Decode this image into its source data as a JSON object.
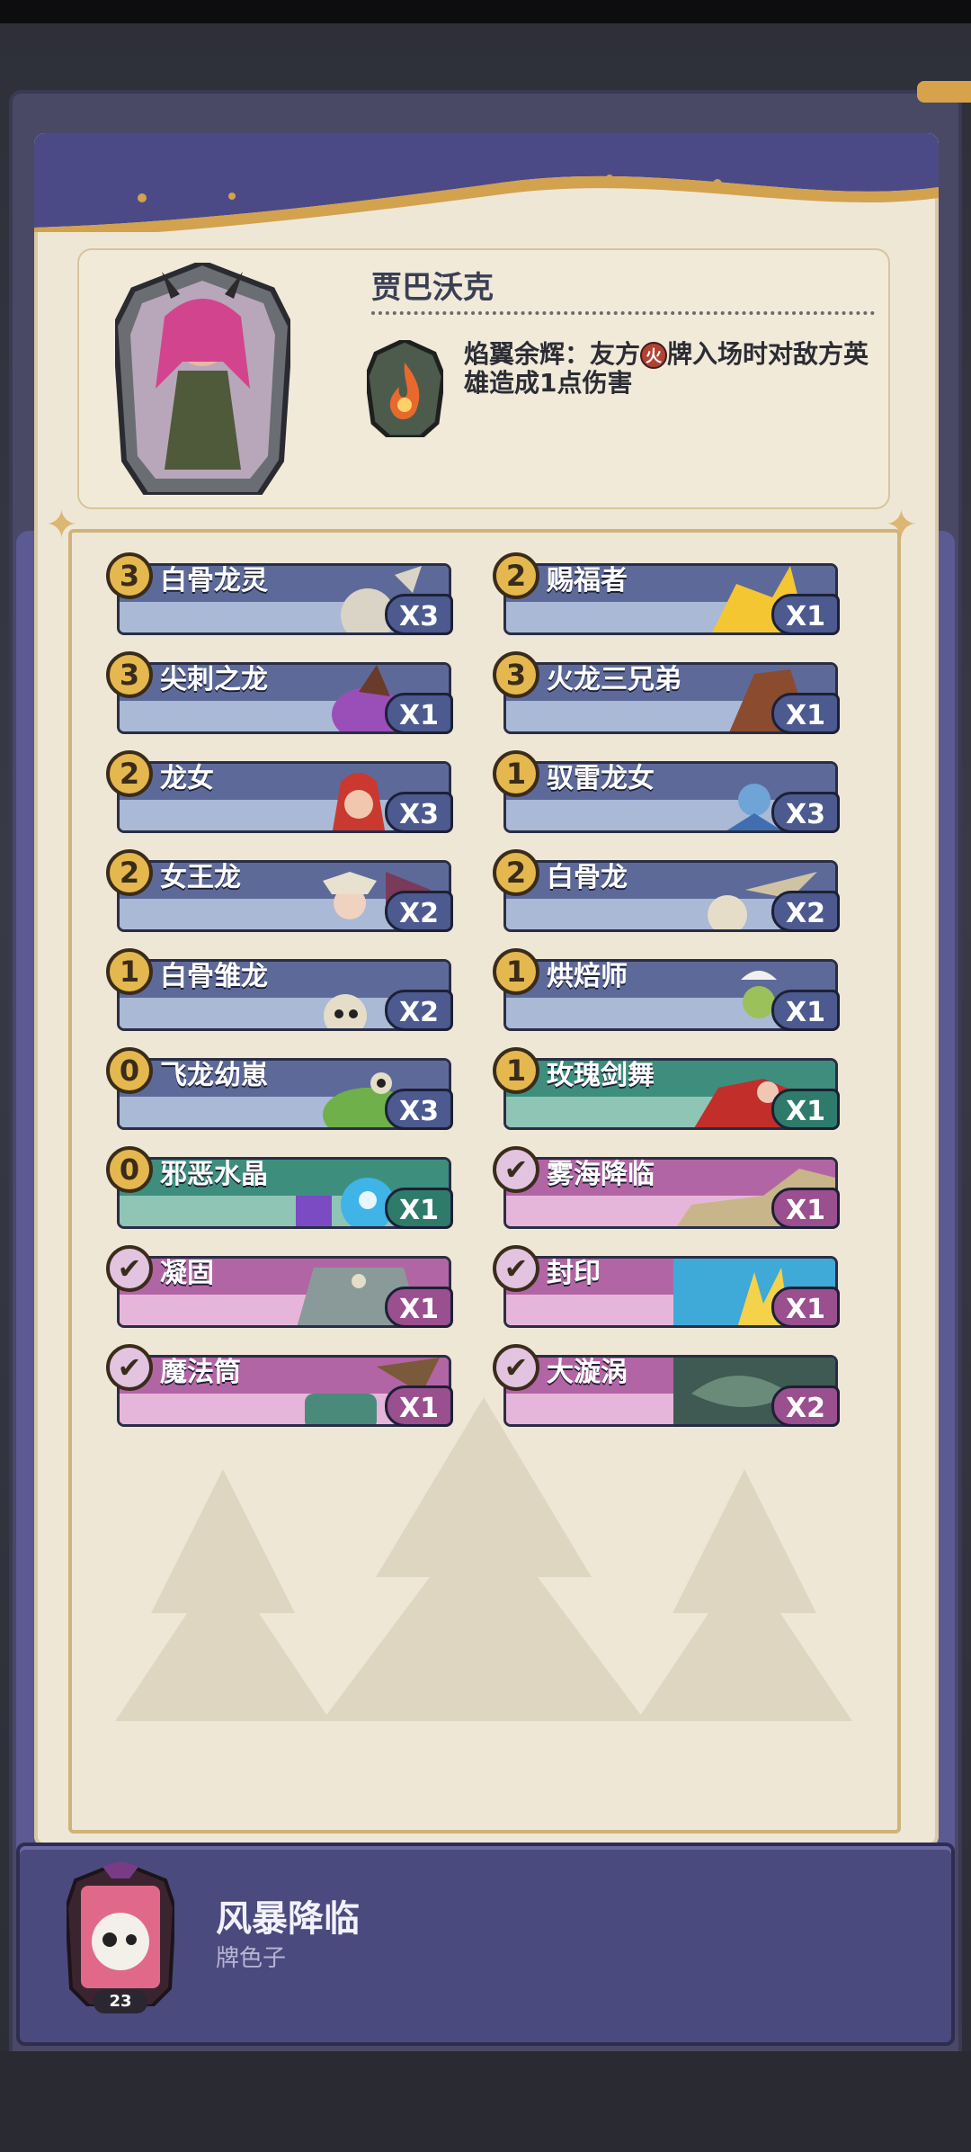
{
  "hero": {
    "name": "贾巴沃克",
    "skill_prefix": "焰翼余辉：友方",
    "skill_badge": "火",
    "skill_suffix": "牌入场时对敌方英雄造成1点伤害"
  },
  "cards": [
    {
      "cost": "3",
      "name": "白骨龙灵",
      "count": "X3",
      "style": "blue"
    },
    {
      "cost": "2",
      "name": "赐福者",
      "count": "X1",
      "style": "blue"
    },
    {
      "cost": "3",
      "name": "尖刺之龙",
      "count": "X1",
      "style": "blue"
    },
    {
      "cost": "3",
      "name": "火龙三兄弟",
      "count": "X1",
      "style": "blue"
    },
    {
      "cost": "2",
      "name": "龙女",
      "count": "X3",
      "style": "blue"
    },
    {
      "cost": "1",
      "name": "驭雷龙女",
      "count": "X3",
      "style": "blue"
    },
    {
      "cost": "2",
      "name": "女王龙",
      "count": "X2",
      "style": "blue"
    },
    {
      "cost": "2",
      "name": "白骨龙",
      "count": "X2",
      "style": "blue"
    },
    {
      "cost": "1",
      "name": "白骨雏龙",
      "count": "X2",
      "style": "blue"
    },
    {
      "cost": "1",
      "name": "烘焙师",
      "count": "X1",
      "style": "blue"
    },
    {
      "cost": "0",
      "name": "飞龙幼崽",
      "count": "X3",
      "style": "blue"
    },
    {
      "cost": "1",
      "name": "玫瑰剑舞",
      "count": "X1",
      "style": "green"
    },
    {
      "cost": "0",
      "name": "邪恶水晶",
      "count": "X1",
      "style": "green"
    },
    {
      "cost": "✔",
      "name": "雾海降临",
      "count": "X1",
      "style": "pink"
    },
    {
      "cost": "✔",
      "name": "凝固",
      "count": "X1",
      "style": "pink"
    },
    {
      "cost": "✔",
      "name": "封印",
      "count": "X1",
      "style": "pink"
    },
    {
      "cost": "✔",
      "name": "魔法筒",
      "count": "X1",
      "style": "pink"
    },
    {
      "cost": "✔",
      "name": "大漩涡",
      "count": "X2",
      "style": "pink"
    }
  ],
  "deck": {
    "title": "风暴降临",
    "subtitle": "牌色子",
    "level": "23"
  },
  "colors": {
    "accent_gold": "#e4b84e",
    "panel_purple": "#4a4a7e",
    "card_blue": "#5d6a99",
    "card_green": "#3d8e7d",
    "card_pink": "#b265a4"
  }
}
